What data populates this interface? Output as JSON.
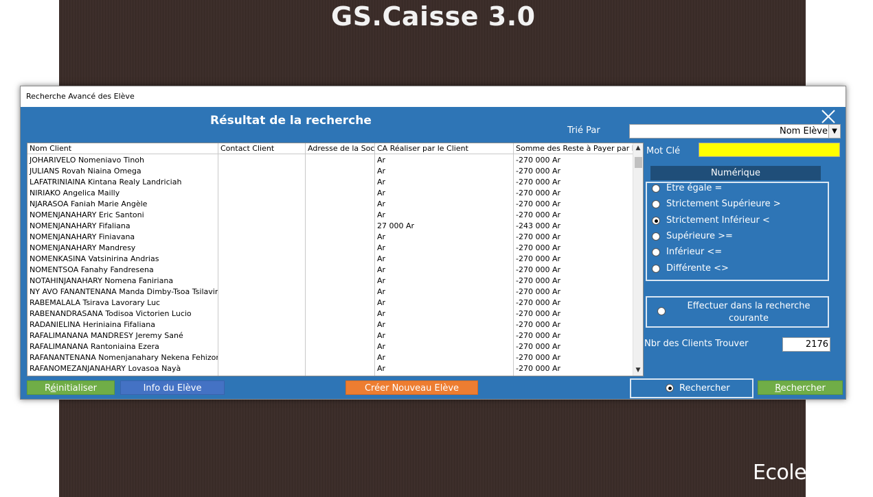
{
  "app": {
    "title": "GS.Caisse 3.0",
    "footer_brand": "Ecole"
  },
  "window": {
    "title": "Recherche Avancé des Elève"
  },
  "heading": "Résultat de la recherche",
  "sort": {
    "label": "Trié Par",
    "value": "Nom Elève"
  },
  "keyword": {
    "label": "Mot Clé",
    "value": ""
  },
  "numeric": {
    "header": "Numérique"
  },
  "radios": [
    {
      "label": "Etre égale =",
      "selected": false
    },
    {
      "label": "Strictement Supérieure >",
      "selected": false
    },
    {
      "label": "Strictement Inférieur <",
      "selected": true
    },
    {
      "label": "Supérieure >=",
      "selected": false
    },
    {
      "label": "Inférieur <=",
      "selected": false
    },
    {
      "label": "Différente <>",
      "selected": false
    }
  ],
  "current_search": {
    "label": "Effectuer dans la recherche courante",
    "selected": false
  },
  "count": {
    "label": "Nbr des Clients Trouver",
    "value": "2176"
  },
  "table": {
    "columns": [
      "Nom Client",
      "Contact Client",
      "Adresse de la Soc",
      "CA Réaliser par le Client",
      "Somme des Reste à Payer par le"
    ],
    "rows": [
      [
        "JOHARIVELO Nomeniavo Tinoh",
        "",
        "",
        "Ar",
        "-270 000 Ar"
      ],
      [
        "JULIANS Rovah Niaina Omega",
        "",
        "",
        "Ar",
        "-270 000 Ar"
      ],
      [
        "LAFATRINIAINA Kintana Realy Landriciah",
        "",
        "",
        "Ar",
        "-270 000 Ar"
      ],
      [
        "NIRIAKO Angelica Mailly",
        "",
        "",
        "Ar",
        "-270 000 Ar"
      ],
      [
        "NJARASOA Faniah Marie Angèle",
        "",
        "",
        "Ar",
        "-270 000 Ar"
      ],
      [
        "NOMENJANAHARY Eric Santoni",
        "",
        "",
        "Ar",
        "-270 000 Ar"
      ],
      [
        "NOMENJANAHARY Fifaliana",
        "",
        "",
        "27 000 Ar",
        "-243 000 Ar"
      ],
      [
        "NOMENJANAHARY Finiavana",
        "",
        "",
        "Ar",
        "-270 000 Ar"
      ],
      [
        "NOMENJANAHARY Mandresy",
        "",
        "",
        "Ar",
        "-270 000 Ar"
      ],
      [
        "NOMENKASINA Vatsinirina Andrias",
        "",
        "",
        "Ar",
        "-270 000 Ar"
      ],
      [
        "NOMENTSOA Fanahy Fandresena",
        "",
        "",
        "Ar",
        "-270 000 Ar"
      ],
      [
        "NOTAHINJANAHARY Nomena Faniriana",
        "",
        "",
        "Ar",
        "-270 000 Ar"
      ],
      [
        "NY AVO FANANTENANA Manda Dimby-Tsoa Tsilavina",
        "",
        "",
        "Ar",
        "-270 000 Ar"
      ],
      [
        "RABEMALALA Tsirava Lavorary Luc",
        "",
        "",
        "Ar",
        "-270 000 Ar"
      ],
      [
        "RABENANDRASANA Todisoa Victorien Lucio",
        "",
        "",
        "Ar",
        "-270 000 Ar"
      ],
      [
        "RADANIELINA Heriniaina Fifaliana",
        "",
        "",
        "Ar",
        "-270 000 Ar"
      ],
      [
        "RAFALIMANANA MANDRESY Jeremy Sané",
        "",
        "",
        "Ar",
        "-270 000 Ar"
      ],
      [
        "RAFALIMANANA Rantoniaina Ezera",
        "",
        "",
        "Ar",
        "-270 000 Ar"
      ],
      [
        "RAFANANTENANA Nomenjanahary Nekena Fehizoro",
        "",
        "",
        "Ar",
        "-270 000 Ar"
      ],
      [
        "RAFANOMEZANJANAHARY Lovasoa Nayà",
        "",
        "",
        "Ar",
        "-270 000 Ar"
      ]
    ]
  },
  "buttons": {
    "reset": {
      "prefix": "R",
      "u": "é",
      "rest": "initialiser"
    },
    "info": "Info du Elève",
    "create": "Créer Nouveau Elève",
    "search_radio": "Rechercher",
    "search": {
      "u": "R",
      "rest": "echercher"
    }
  },
  "colors": {
    "window_bg": "#2e75b6",
    "keyword_bg": "#ffff00",
    "green": "#70ad47",
    "blue": "#4472c4",
    "orange": "#ed7d31",
    "header_dark": "#1f4e79"
  },
  "icons": {
    "close": "close-icon",
    "dropdown": "chevron-down-icon",
    "scroll_up": "scroll-up-icon",
    "scroll_down": "scroll-down-icon"
  }
}
